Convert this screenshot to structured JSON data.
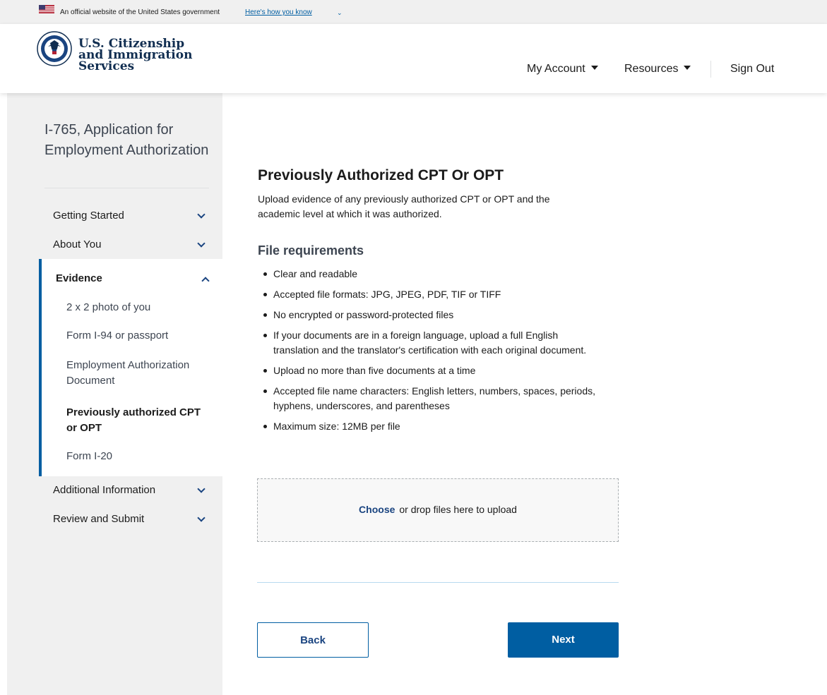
{
  "gov_banner": {
    "text": "An official website of the United States government",
    "link_label": "Here's how you know",
    "chevron": "⌄"
  },
  "header": {
    "agency_lines": [
      "U.S. Citizenship",
      "and Immigration",
      "Services"
    ],
    "nav": {
      "my_account": "My Account",
      "resources": "Resources",
      "sign_out": "Sign Out"
    }
  },
  "sidebar": {
    "form_title": "I-765, Application for Employment Authorization",
    "sections": [
      {
        "label": "Getting Started",
        "expanded": false
      },
      {
        "label": "About You",
        "expanded": false
      },
      {
        "label": "Evidence",
        "expanded": true
      },
      {
        "label": "Additional Information",
        "expanded": false
      },
      {
        "label": "Review and Submit",
        "expanded": false
      }
    ],
    "evidence_items": [
      {
        "label": "2 x 2 photo of you"
      },
      {
        "label": "Form I-94 or passport"
      },
      {
        "label": "Employment Authorization Document"
      },
      {
        "label": "Previously authorized CPT or OPT",
        "current": true
      },
      {
        "label": "Form I-20"
      }
    ]
  },
  "main": {
    "heading": "Previously Authorized CPT Or OPT",
    "intro": "Upload evidence of any previously authorized CPT or OPT and the academic level at which it was authorized.",
    "requirements_heading": "File requirements",
    "requirements": [
      "Clear and readable",
      "Accepted file formats: JPG, JPEG, PDF, TIF or TIFF",
      "No encrypted or password-protected files",
      "If your documents are in a foreign language, upload a full English translation and the translator's certification with each original document.",
      "Upload no more than five documents at a time",
      "Accepted file name characters: English letters, numbers, spaces, periods, hyphens, underscores, and parentheses",
      "Maximum size: 12MB per file"
    ],
    "upload": {
      "choose_label": "Choose",
      "rest_label": "or drop files here to upload"
    },
    "buttons": {
      "back": "Back",
      "next": "Next"
    }
  },
  "colors": {
    "primary": "#005ea2",
    "primary_dark": "#1a4480",
    "agency_navy": "#112e51",
    "sidebar_bg": "#f0f0f0"
  },
  "icons": [
    "us-flag-icon",
    "dhs-seal-icon",
    "caret-down-icon",
    "chevron-down-icon",
    "chevron-up-icon"
  ]
}
